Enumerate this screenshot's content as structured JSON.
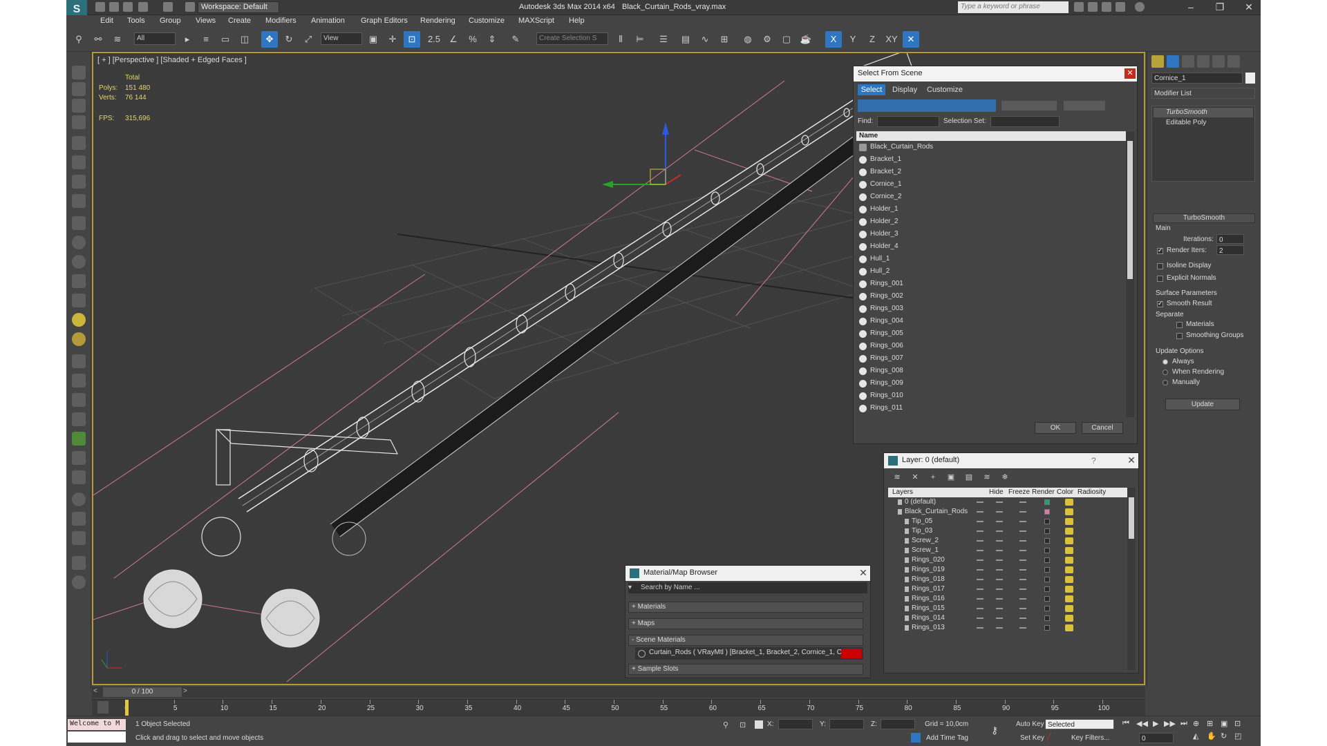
{
  "app": {
    "title": "Autodesk 3ds Max  2014 x64",
    "file": "Black_Curtain_Rods_vray.max",
    "workspace": "Workspace: Default",
    "search_placeholder": "Type a keyword or phrase"
  },
  "menu": [
    "Edit",
    "Tools",
    "Group",
    "Views",
    "Create",
    "Modifiers",
    "Animation",
    "Graph Editors",
    "Rendering",
    "Customize",
    "MAXScript",
    "Help"
  ],
  "toolbar": {
    "filter_value": "All",
    "refcoord_value": "View",
    "selection_set_placeholder": "Create Selection S",
    "axes": [
      "X",
      "Y",
      "Z",
      "XY"
    ],
    "snap_labels": [
      "2.5",
      "%"
    ]
  },
  "viewport": {
    "label": "[ + ] [Perspective ] [Shaded + Edged Faces ]",
    "stats": {
      "total_label": "Total",
      "polys_label": "Polys:",
      "polys_value": "151 480",
      "verts_label": "Verts:",
      "verts_value": "76 144",
      "fps_label": "FPS:",
      "fps_value": "315,696"
    },
    "accent": "#b89a2e"
  },
  "command_panel": {
    "object_name": "Cornice_1",
    "modifier_list": "Modifier List",
    "stack": [
      "TurboSmooth",
      "Editable Poly"
    ],
    "rollout": "TurboSmooth",
    "main_group": "Main",
    "iterations_label": "Iterations:",
    "iterations_value": "0",
    "render_iters_label": "Render Iters:",
    "render_iters_value": "2",
    "isoline_label": "Isoline Display",
    "explicit_label": "Explicit Normals",
    "surface_group": "Surface Parameters",
    "smooth_result_label": "Smooth Result",
    "separate_label": "Separate",
    "materials_label": "Materials",
    "smoothing_groups_label": "Smoothing Groups",
    "update_group": "Update Options",
    "always_label": "Always",
    "when_rendering_label": "When Rendering",
    "manually_label": "Manually",
    "update_button": "Update"
  },
  "select_from_scene": {
    "title": "Select From Scene",
    "tabs": [
      "Select",
      "Display",
      "Customize"
    ],
    "find_label": "Find:",
    "selection_set_label": "Selection Set:",
    "column_name": "Name",
    "items": [
      "Black_Curtain_Rods",
      "Bracket_1",
      "Bracket_2",
      "Cornice_1",
      "Cornice_2",
      "Holder_1",
      "Holder_2",
      "Holder_3",
      "Holder_4",
      "Hull_1",
      "Hull_2",
      "Rings_001",
      "Rings_002",
      "Rings_003",
      "Rings_004",
      "Rings_005",
      "Rings_006",
      "Rings_007",
      "Rings_008",
      "Rings_009",
      "Rings_010",
      "Rings_011"
    ],
    "ok": "OK",
    "cancel": "Cancel"
  },
  "layer_dialog": {
    "title": "Layer: 0 (default)",
    "help": "?",
    "columns": [
      "Layers",
      "Hide",
      "Freeze",
      "Render",
      "Color",
      "Radiosity"
    ],
    "rows": [
      {
        "name": "0 (default)",
        "indent": 0,
        "color": "#1fa37a"
      },
      {
        "name": "Black_Curtain_Rods",
        "indent": 0,
        "color": "#d97aa8"
      },
      {
        "name": "Tip_05",
        "indent": 1,
        "color": ""
      },
      {
        "name": "Tip_03",
        "indent": 1,
        "color": ""
      },
      {
        "name": "Screw_2",
        "indent": 1,
        "color": ""
      },
      {
        "name": "Screw_1",
        "indent": 1,
        "color": ""
      },
      {
        "name": "Rings_020",
        "indent": 1,
        "color": ""
      },
      {
        "name": "Rings_019",
        "indent": 1,
        "color": ""
      },
      {
        "name": "Rings_018",
        "indent": 1,
        "color": ""
      },
      {
        "name": "Rings_017",
        "indent": 1,
        "color": ""
      },
      {
        "name": "Rings_016",
        "indent": 1,
        "color": ""
      },
      {
        "name": "Rings_015",
        "indent": 1,
        "color": ""
      },
      {
        "name": "Rings_014",
        "indent": 1,
        "color": ""
      },
      {
        "name": "Rings_013",
        "indent": 1,
        "color": ""
      }
    ]
  },
  "material_browser": {
    "title": "Material/Map Browser",
    "search_placeholder": "Search by Name ...",
    "sections": [
      "+ Materials",
      "+ Maps",
      "- Scene Materials",
      "+ Sample Slots"
    ],
    "scene_material": "Curtain_Rods  ( VRayMtl )  [Bracket_1, Bracket_2, Cornice_1, Cor..."
  },
  "timeline": {
    "frame": "0 / 100",
    "ticks": [
      "0",
      "5",
      "10",
      "15",
      "20",
      "25",
      "30",
      "35",
      "40",
      "45",
      "50",
      "55",
      "60",
      "65",
      "70",
      "75",
      "80",
      "85",
      "90",
      "95",
      "100"
    ]
  },
  "status": {
    "maxscript": "Welcome to M",
    "selected": "1 Object Selected",
    "prompt": "Click and drag to select and move objects",
    "x_label": "X:",
    "y_label": "Y:",
    "z_label": "Z:",
    "grid": "Grid = 10,0cm",
    "add_time_tag": "Add Time Tag",
    "auto_key": "Auto Key",
    "set_key": "Set Key",
    "selected_dd": "Selected",
    "key_filters": "Key Filters...",
    "frame_value": "0"
  }
}
